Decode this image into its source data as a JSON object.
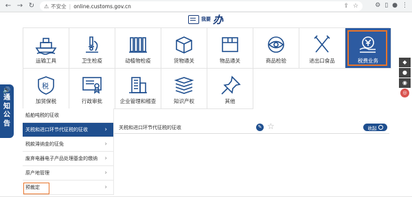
{
  "browser": {
    "back": "←",
    "forward": "→",
    "reload": "↻",
    "security": "不安全",
    "url": "online.customs.gov.cn"
  },
  "header": {
    "logo_word": "我要",
    "logo_big": "办"
  },
  "tiles": [
    {
      "label": "运输工具",
      "icon": "ship-icon"
    },
    {
      "label": "卫生检疫",
      "icon": "microscope-icon"
    },
    {
      "label": "动植物检疫",
      "icon": "plant-bars-icon"
    },
    {
      "label": "货物通关",
      "icon": "box-icon"
    },
    {
      "label": "物品通关",
      "icon": "package-icon"
    },
    {
      "label": "商品检验",
      "icon": "eye-icon"
    },
    {
      "label": "进出口食品",
      "icon": "fork-knife-icon"
    },
    {
      "label": "税费业务",
      "icon": "yen-hand-icon"
    },
    {
      "label": "加贸保税",
      "icon": "tax-shield-icon"
    },
    {
      "label": "行政审批",
      "icon": "certificate-icon"
    },
    {
      "label": "企业管理和稽查",
      "icon": "building-icon"
    },
    {
      "label": "知识产权",
      "icon": "books-icon"
    },
    {
      "label": "其他",
      "icon": "pin-icon"
    }
  ],
  "notice": {
    "chars": [
      "通",
      "知",
      "公",
      "告"
    ]
  },
  "menu": [
    {
      "label": "船舶吨税的征收"
    },
    {
      "label": "关税和进口环节代征税的征收"
    },
    {
      "label": "税款滞纳金的征免"
    },
    {
      "label": "废弃电器电子产品处理基金的缴纳"
    },
    {
      "label": "原产地管理"
    },
    {
      "label": "预裁定"
    }
  ],
  "content": {
    "title": "关税和进口环节代征税的征收",
    "collapse_label": "收起"
  },
  "colors": {
    "primary": "#1f4f8f",
    "highlight": "#e8742a",
    "active_tile": "#2d5ba1"
  }
}
